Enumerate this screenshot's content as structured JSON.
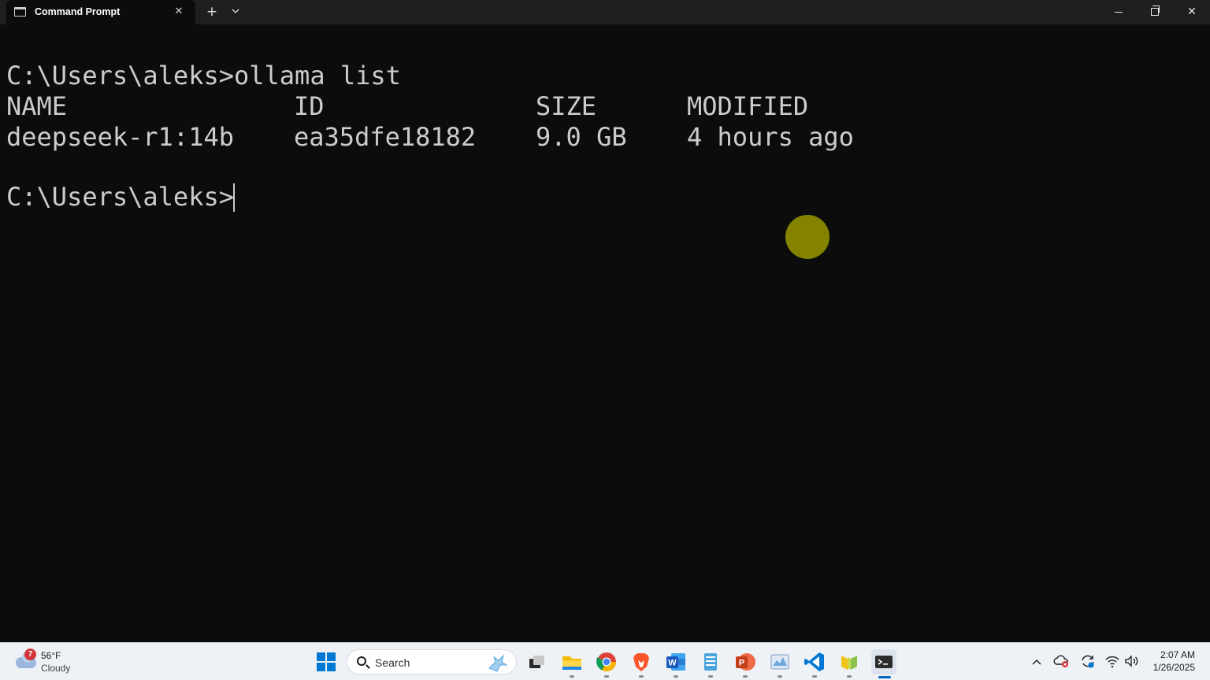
{
  "window": {
    "tab_title": "Command Prompt",
    "tab_close": "✕",
    "new_tab": "+",
    "tab_menu": "⌄",
    "close": "✕"
  },
  "terminal": {
    "command_line": "C:\\Users\\aleks>ollama list",
    "headers": [
      "NAME",
      "ID",
      "SIZE",
      "MODIFIED"
    ],
    "rows": [
      [
        "deepseek-r1:14b",
        "ea35dfe18182",
        "9.0 GB",
        "4 hours ago"
      ]
    ],
    "prompt": "C:\\Users\\aleks>",
    "background": "#0c0c0c",
    "foreground": "#cccccc",
    "cursor_highlight": "#8a8a00"
  },
  "taskbar": {
    "weather": {
      "badge": "7",
      "temp": "56°F",
      "condition": "Cloudy"
    },
    "search_label": "Search",
    "apps": [
      "start-icon",
      "task-view-icon",
      "file-explorer-icon",
      "chrome-icon",
      "brave-icon",
      "word-icon",
      "notepad-icon",
      "powerpoint-icon",
      "task-manager-icon",
      "vscode-icon",
      "app-icon",
      "terminal-icon"
    ],
    "tray": {
      "overflow": "^",
      "time": "2:07 AM",
      "date": "1/26/2025"
    }
  }
}
